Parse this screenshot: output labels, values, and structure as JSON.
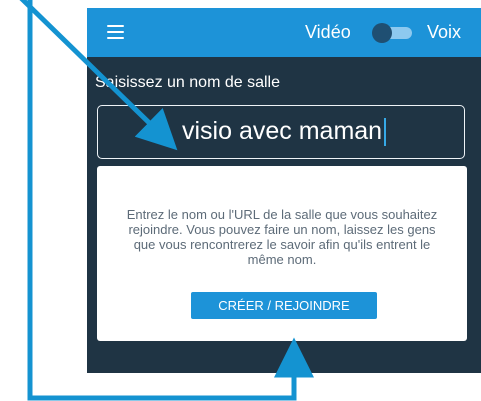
{
  "appbar": {
    "menu_icon": "hamburger-menu-icon",
    "video_label": "Vidéo",
    "voice_label": "Voix",
    "toggle_color": "#8dc9ef",
    "accent_color": "#1d93d8"
  },
  "room": {
    "prompt": "Saisissez un nom de salle",
    "value": "visio avec maman"
  },
  "help": {
    "text": "Entrez le nom ou l'URL de la salle que vous souhaitez rejoindre. Vous pouvez faire un nom, laissez les gens que vous rencontrerez le savoir afin qu'ils entrent le même nom.",
    "button_label": "CRÉER / REJOINDRE"
  },
  "annotation": {
    "arrow_color": "#1493d1"
  }
}
